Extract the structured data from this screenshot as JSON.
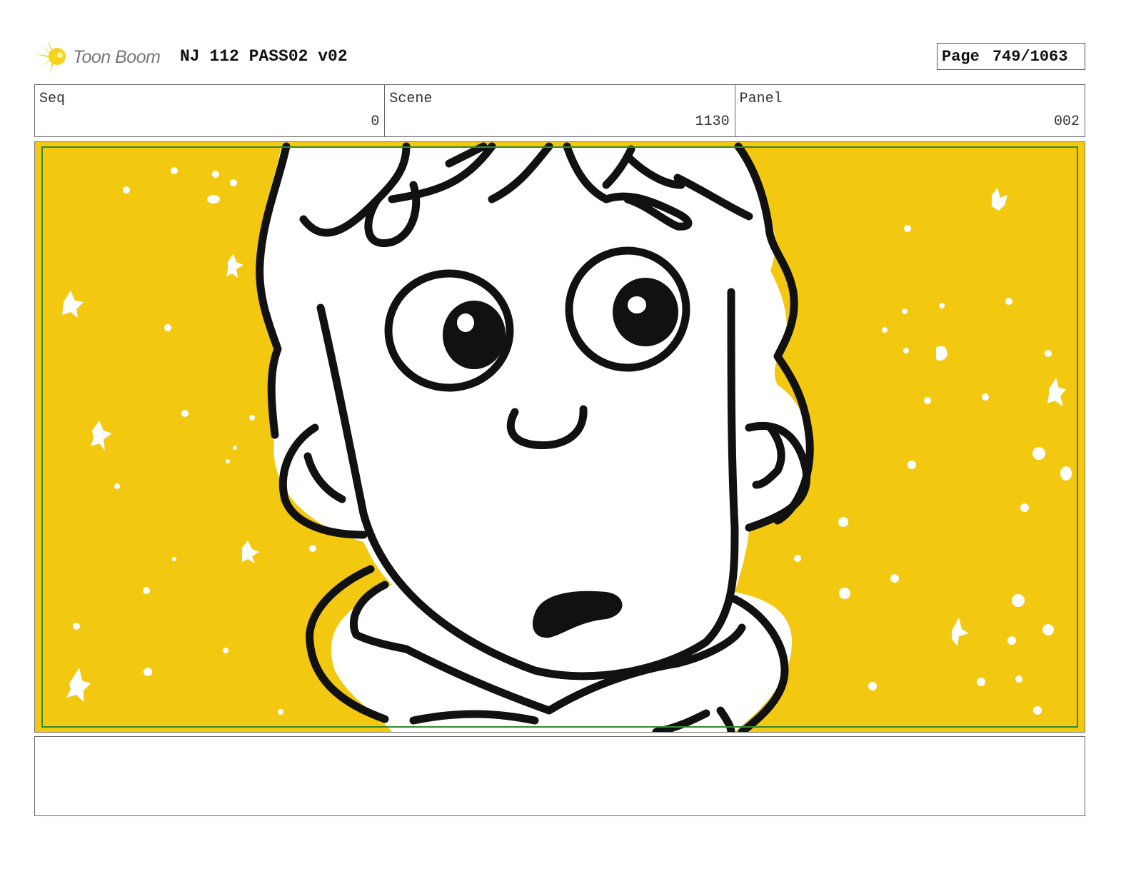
{
  "header": {
    "logo_text": "Toon Boom",
    "title": "NJ 112 PASS02 v02",
    "page_label": "Page",
    "page_value": "749/1063"
  },
  "info": {
    "seq_label": "Seq",
    "seq_value": "0",
    "scene_label": "Scene",
    "scene_value": "1130",
    "panel_label": "Panel",
    "panel_value": "002"
  },
  "colors": {
    "background_yellow": "#f2c811",
    "safe_frame_green": "#2f8a2f",
    "ink": "#111111"
  },
  "icons": [
    "toon-boom-logo-icon"
  ],
  "notes": ""
}
